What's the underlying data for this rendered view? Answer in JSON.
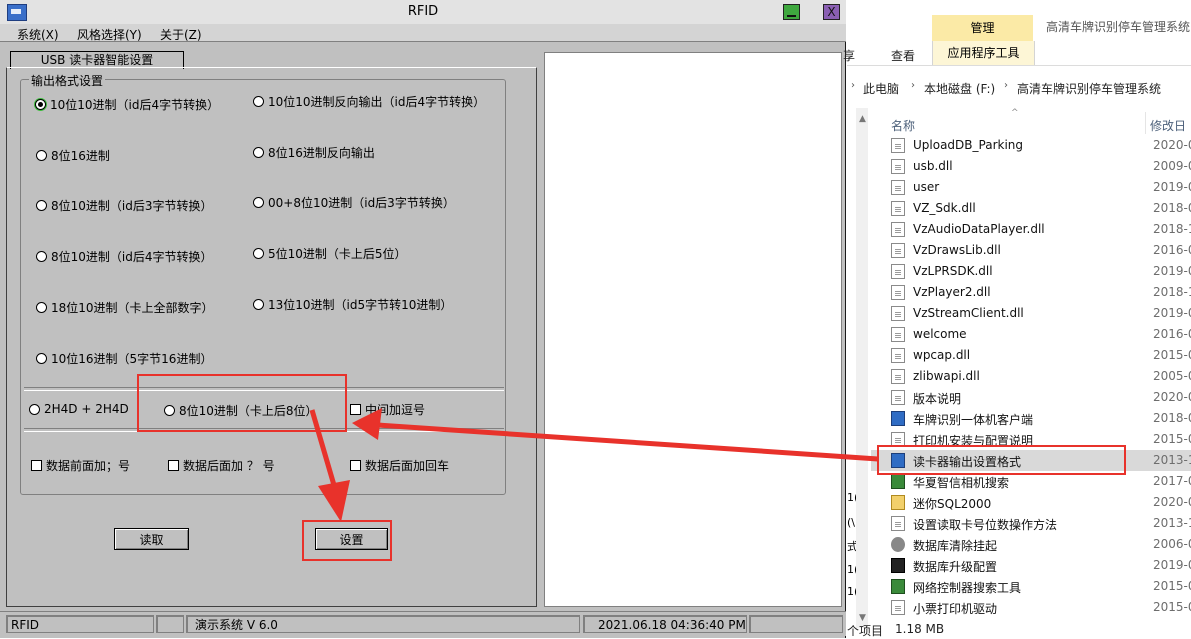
{
  "rfid": {
    "title": "RFID",
    "menu": [
      "系统(X)",
      "风格选择(Y)",
      "关于(Z)"
    ],
    "close_glyph": "X",
    "tab_label": "USB 读卡器智能设置",
    "group_legend": "输出格式设置",
    "radios": [
      {
        "label": "10位10进制（id后4字节转换）",
        "checked": true
      },
      {
        "label": "10位10进制反向输出（id后4字节转换）",
        "checked": false
      },
      {
        "label": "8位16进制",
        "checked": false
      },
      {
        "label": "8位16进制反向输出",
        "checked": false
      },
      {
        "label": "8位10进制（id后3字节转换）",
        "checked": false
      },
      {
        "label": "00+8位10进制（id后3字节转换）",
        "checked": false
      },
      {
        "label": "8位10进制（id后4字节转换）",
        "checked": false
      },
      {
        "label": "5位10进制（卡上后5位）",
        "checked": false
      },
      {
        "label": "18位10进制（卡上全部数字）",
        "checked": false
      },
      {
        "label": "13位10进制（id5字节转10进制）",
        "checked": false
      },
      {
        "label": "10位16进制（5字节16进制）",
        "checked": false
      },
      {
        "label": "2H4D + 2H4D",
        "checked": false
      },
      {
        "label": "8位10进制（卡上后8位）",
        "checked": false
      }
    ],
    "checkboxes": [
      {
        "label": "中间加逗号",
        "checked": false
      },
      {
        "label": "数据前面加；号",
        "checked": false
      },
      {
        "label": "数据后面加 ？ 号",
        "checked": false
      },
      {
        "label": "数据后面加回车",
        "checked": false
      }
    ],
    "read_button": "读取",
    "set_button": "设置",
    "status": [
      "RFID",
      "",
      "演示系统  V 6.0",
      "2021.06.18   04:36:40 PM",
      ""
    ]
  },
  "explorer": {
    "tabs": {
      "manage": "管理",
      "app_tools": "应用程序工具",
      "view": "查看",
      "share": "享",
      "folder_title": "高清车牌识别停车管理系统"
    },
    "breadcrumb": [
      "此电脑",
      "本地磁盘 (F:)",
      "高清车牌识别停车管理系统"
    ],
    "columns": {
      "name": "名称",
      "date": "修改日"
    },
    "files": [
      {
        "name": "UploadDB_Parking",
        "date": "2020-0",
        "icon": "doc-icon"
      },
      {
        "name": "usb.dll",
        "date": "2009-0",
        "icon": "doc-icon"
      },
      {
        "name": "user",
        "date": "2019-0",
        "icon": "doc-icon"
      },
      {
        "name": "VZ_Sdk.dll",
        "date": "2018-0",
        "icon": "doc-icon"
      },
      {
        "name": "VzAudioDataPlayer.dll",
        "date": "2018-1",
        "icon": "doc-icon"
      },
      {
        "name": "VzDrawsLib.dll",
        "date": "2016-0",
        "icon": "doc-icon"
      },
      {
        "name": "VzLPRSDK.dll",
        "date": "2019-0",
        "icon": "doc-icon"
      },
      {
        "name": "VzPlayer2.dll",
        "date": "2018-1",
        "icon": "doc-icon"
      },
      {
        "name": "VzStreamClient.dll",
        "date": "2019-0",
        "icon": "doc-icon"
      },
      {
        "name": "welcome",
        "date": "2016-0",
        "icon": "doc-icon"
      },
      {
        "name": "wpcap.dll",
        "date": "2015-0",
        "icon": "doc-icon"
      },
      {
        "name": "zlibwapi.dll",
        "date": "2005-0",
        "icon": "doc-icon"
      },
      {
        "name": "版本说明",
        "date": "2020-0",
        "icon": "doc-icon"
      },
      {
        "name": "车牌识别一体机客户端",
        "date": "2018-0",
        "icon": "app-icon"
      },
      {
        "name": "打印机安装与配置说明",
        "date": "2015-0",
        "icon": "doc-icon"
      },
      {
        "name": "读卡器输出设置格式",
        "date": "2013-1",
        "icon": "app-icon",
        "selected": true
      },
      {
        "name": "华夏智信相机搜索",
        "date": "2017-0",
        "icon": "tool-icon"
      },
      {
        "name": "迷你SQL2000",
        "date": "2020-0",
        "icon": "zip-icon"
      },
      {
        "name": "设置读取卡号位数操作方法",
        "date": "2013-1",
        "icon": "doc-icon"
      },
      {
        "name": "数据库清除挂起",
        "date": "2006-0",
        "icon": "gear-icon"
      },
      {
        "name": "数据库升级配置",
        "date": "2019-0",
        "icon": "dark-icon"
      },
      {
        "name": "网络控制器搜索工具",
        "date": "2015-0",
        "icon": "tool-icon"
      },
      {
        "name": "小票打印机驱动",
        "date": "2015-0",
        "icon": "doc-icon"
      }
    ],
    "status": {
      "items": "个项目",
      "size": "1.18 MB"
    },
    "nav_fragments": [
      "1(",
      "(\\",
      "式",
      "1(",
      "1("
    ]
  }
}
